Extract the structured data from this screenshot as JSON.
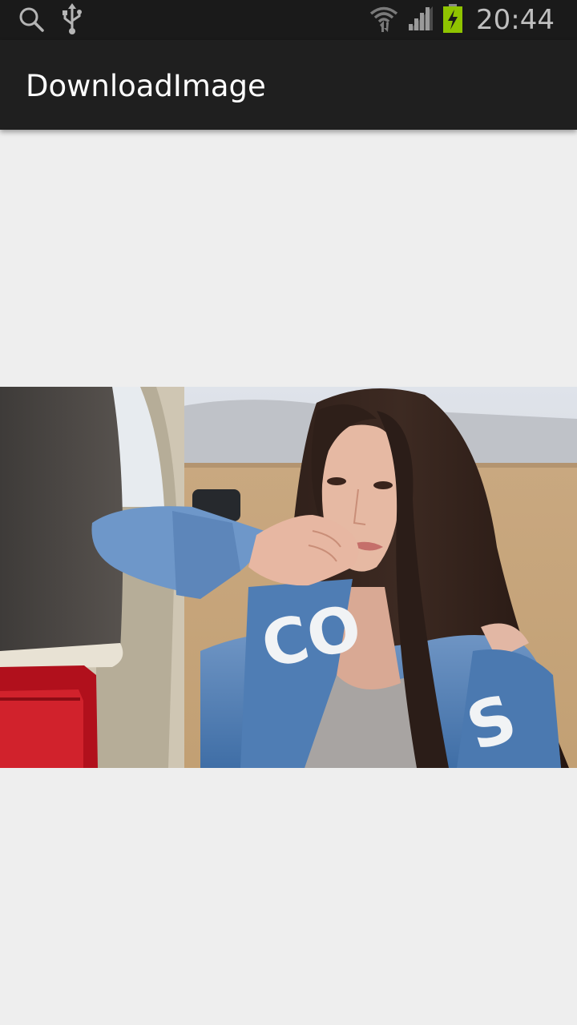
{
  "status_bar": {
    "time": "20:44",
    "icons": [
      "search-icon",
      "usb-icon",
      "wifi-icon",
      "signal-icon",
      "battery-charging-icon"
    ],
    "battery_color": "#8fc400"
  },
  "action_bar": {
    "title": "DownloadImage",
    "background": "#1f1f1f"
  },
  "content": {
    "background": "#eeeeee",
    "image": "downloaded-photo"
  }
}
